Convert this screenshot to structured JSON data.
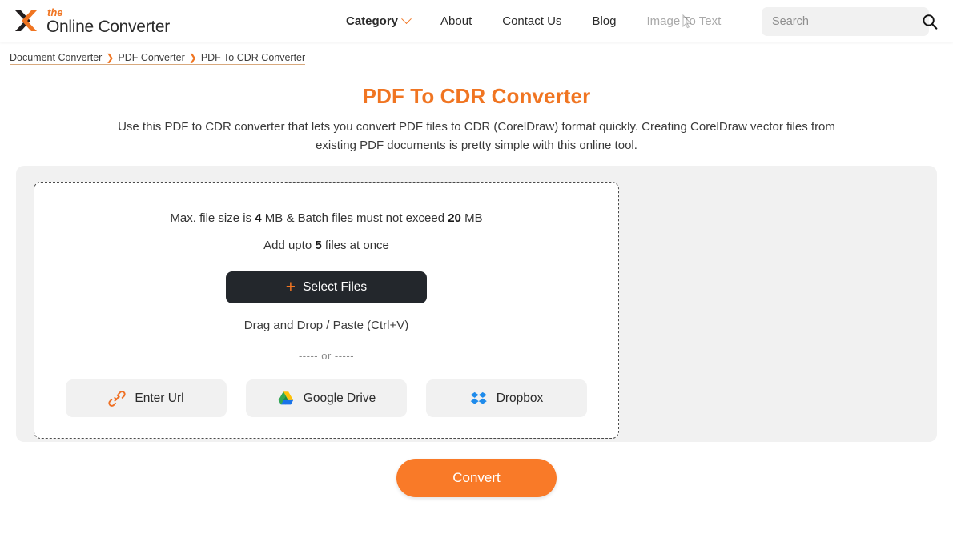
{
  "header": {
    "logo": {
      "mark": "chevron-logo-icon",
      "the": "the",
      "name": "Online Converter",
      "mark_dark_color": "#231f20",
      "mark_orange_color": "#f07522"
    },
    "nav": [
      {
        "label": "Category",
        "bold": true,
        "muted": false,
        "caret": true
      },
      {
        "label": "About",
        "bold": false,
        "muted": false,
        "caret": false
      },
      {
        "label": "Contact Us",
        "bold": false,
        "muted": false,
        "caret": false
      },
      {
        "label": "Blog",
        "bold": false,
        "muted": false,
        "caret": false
      },
      {
        "label": "Image To Text",
        "bold": false,
        "muted": true,
        "caret": false
      }
    ],
    "search": {
      "placeholder": "Search",
      "value": "",
      "icon": "search-icon"
    }
  },
  "breadcrumb": {
    "items": [
      {
        "label": "Document Converter"
      },
      {
        "label": "PDF Converter"
      },
      {
        "label": "PDF To CDR Converter"
      }
    ],
    "separator": "❯"
  },
  "main": {
    "title": "PDF To CDR Converter",
    "description": "Use this PDF to CDR converter that lets you convert PDF files to CDR (CorelDraw) format quickly. Creating CorelDraw vector files from existing PDF documents is pretty simple with this online tool.",
    "title_color": "#f07522"
  },
  "upload": {
    "limits_prefix": "Max. file size is ",
    "max_file_size": "4",
    "limits_middle": " MB & Batch files must not exceed ",
    "batch_size": "20",
    "limits_suffix": " MB",
    "addupto_prefix": "Add upto ",
    "max_files": "5",
    "addupto_suffix": " files at once",
    "select_files_label": "Select Files",
    "plus_glyph": "+",
    "drag_hint": "Drag and Drop / Paste (Ctrl+V)",
    "or_divider": "----- or -----",
    "sources": [
      {
        "label": "Enter Url",
        "icon": "link-chain-icon"
      },
      {
        "label": "Google Drive",
        "icon": "google-drive-icon"
      },
      {
        "label": "Dropbox",
        "icon": "dropbox-icon"
      }
    ]
  },
  "convert": {
    "label": "Convert",
    "color": "#f97a28"
  }
}
